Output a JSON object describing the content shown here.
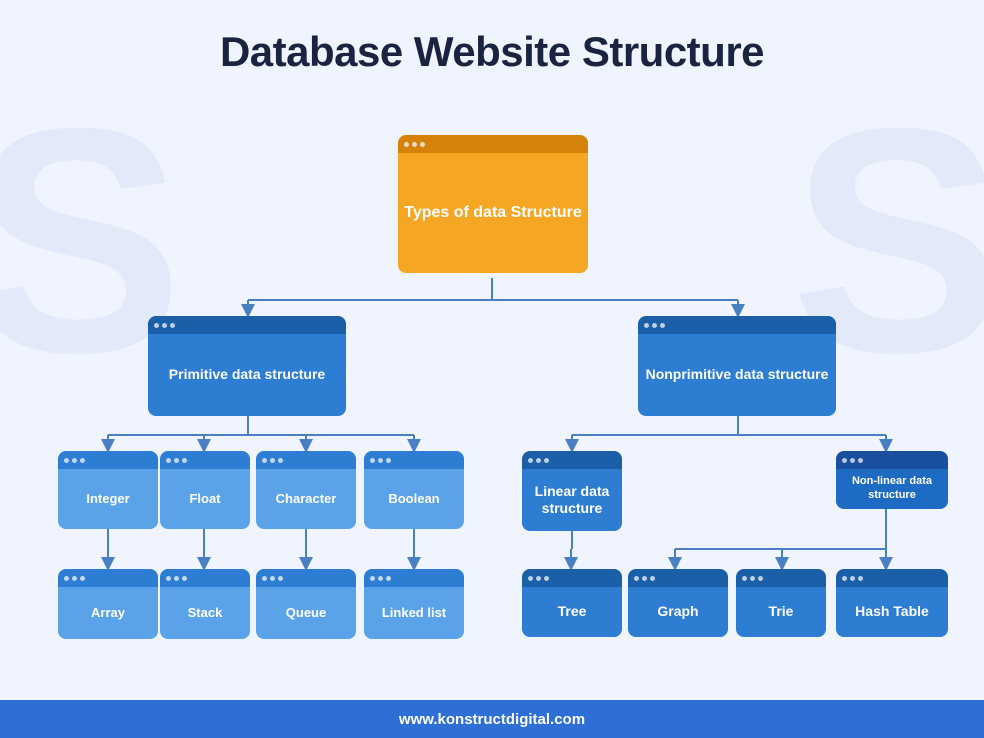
{
  "page": {
    "title": "Database Website Structure",
    "footer": "www.konstructdigital.com"
  },
  "nodes": {
    "root": {
      "label": "Types of data Structure"
    },
    "primitive": {
      "label": "Primitive data structure"
    },
    "nonprimitive": {
      "label": "Nonprimitive data structure"
    },
    "integer": {
      "label": "Integer"
    },
    "float": {
      "label": "Float"
    },
    "character": {
      "label": "Character"
    },
    "boolean": {
      "label": "Boolean"
    },
    "array": {
      "label": "Array"
    },
    "stack": {
      "label": "Stack"
    },
    "queue": {
      "label": "Queue"
    },
    "linkedlist": {
      "label": "Linked list"
    },
    "linear": {
      "label": "Linear data structure"
    },
    "nonlinear": {
      "label": "Non-linear data structure"
    },
    "tree": {
      "label": "Tree"
    },
    "graph": {
      "label": "Graph"
    },
    "trie": {
      "label": "Trie"
    },
    "hashtable": {
      "label": "Hash Table"
    }
  }
}
